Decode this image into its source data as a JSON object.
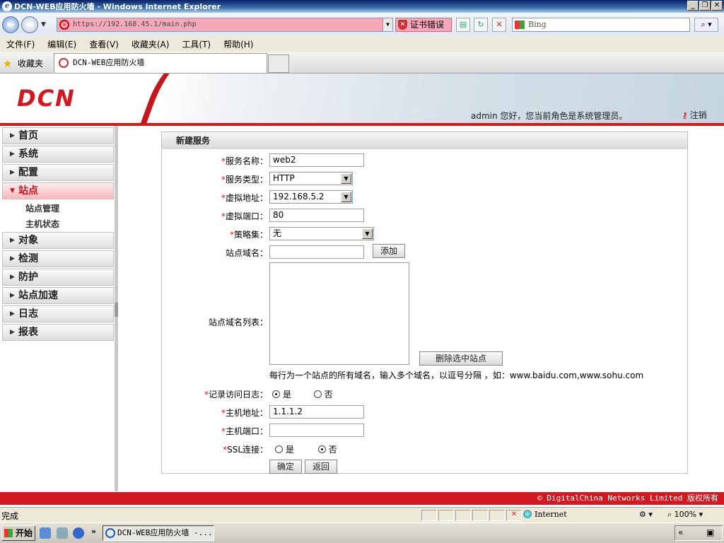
{
  "window": {
    "title": "DCN-WEB应用防火墙 - Windows Internet Explorer"
  },
  "browser": {
    "url": "https://192.168.45.1/main.php",
    "cert_error": "证书错误",
    "search_placeholder": "Bing",
    "menu": [
      "文件(F)",
      "编辑(E)",
      "查看(V)",
      "收藏夹(A)",
      "工具(T)",
      "帮助(H)"
    ],
    "favorites_label": "收藏夹",
    "tab_title": "DCN-WEB应用防火墙"
  },
  "header": {
    "logo": "DCN",
    "welcome": "admin 您好，您当前角色是系统管理员。",
    "logout": "注销"
  },
  "sidebar": {
    "items": [
      {
        "label": "首页",
        "expanded": false
      },
      {
        "label": "系统",
        "expanded": false
      },
      {
        "label": "配置",
        "expanded": false
      },
      {
        "label": "站点",
        "expanded": true,
        "children": [
          "站点管理",
          "主机状态"
        ]
      },
      {
        "label": "对象",
        "expanded": false
      },
      {
        "label": "检测",
        "expanded": false
      },
      {
        "label": "防护",
        "expanded": false
      },
      {
        "label": "站点加速",
        "expanded": false
      },
      {
        "label": "日志",
        "expanded": false
      },
      {
        "label": "报表",
        "expanded": false
      }
    ]
  },
  "form": {
    "title": "新建服务",
    "service_name": {
      "label": "服务名称：",
      "required": true,
      "value": "web2"
    },
    "service_type": {
      "label": "服务类型：",
      "required": true,
      "value": "HTTP"
    },
    "virtual_ip": {
      "label": "虚拟地址：",
      "required": true,
      "value": "192.168.5.2"
    },
    "virtual_port": {
      "label": "虚拟端口：",
      "required": true,
      "value": "80"
    },
    "policy_set": {
      "label": "策略集：",
      "required": true,
      "value": "无"
    },
    "domain": {
      "label": "站点域名：",
      "required": false,
      "value": "",
      "add_button": "添加"
    },
    "domain_list": {
      "label": "站点域名列表：",
      "delete_button": "删除选中站点",
      "hint": "每行为一个站点的所有域名，输入多个域名，以逗号分隔 ，如：www.baidu.com,www.sohu.com"
    },
    "access_log": {
      "label": "记录访问日志：",
      "required": true,
      "options": [
        "是",
        "否"
      ],
      "selected": "是"
    },
    "host_ip": {
      "label": "主机地址：",
      "required": true,
      "value": "1.1.1.2"
    },
    "host_port": {
      "label": "主机端口：",
      "required": true,
      "value": ""
    },
    "ssl": {
      "label": "SSL连接：",
      "required": true,
      "options": [
        "是",
        "否"
      ],
      "selected": "否"
    },
    "ok_button": "确定",
    "back_button": "返回"
  },
  "footer": {
    "copyright": "© DigitalChina Networks Limited 版权所有"
  },
  "status": {
    "text": "完成",
    "zone": "Internet",
    "zoom": "100%"
  },
  "taskbar": {
    "start": "开始",
    "task": "DCN-WEB应用防火墙 -..."
  }
}
